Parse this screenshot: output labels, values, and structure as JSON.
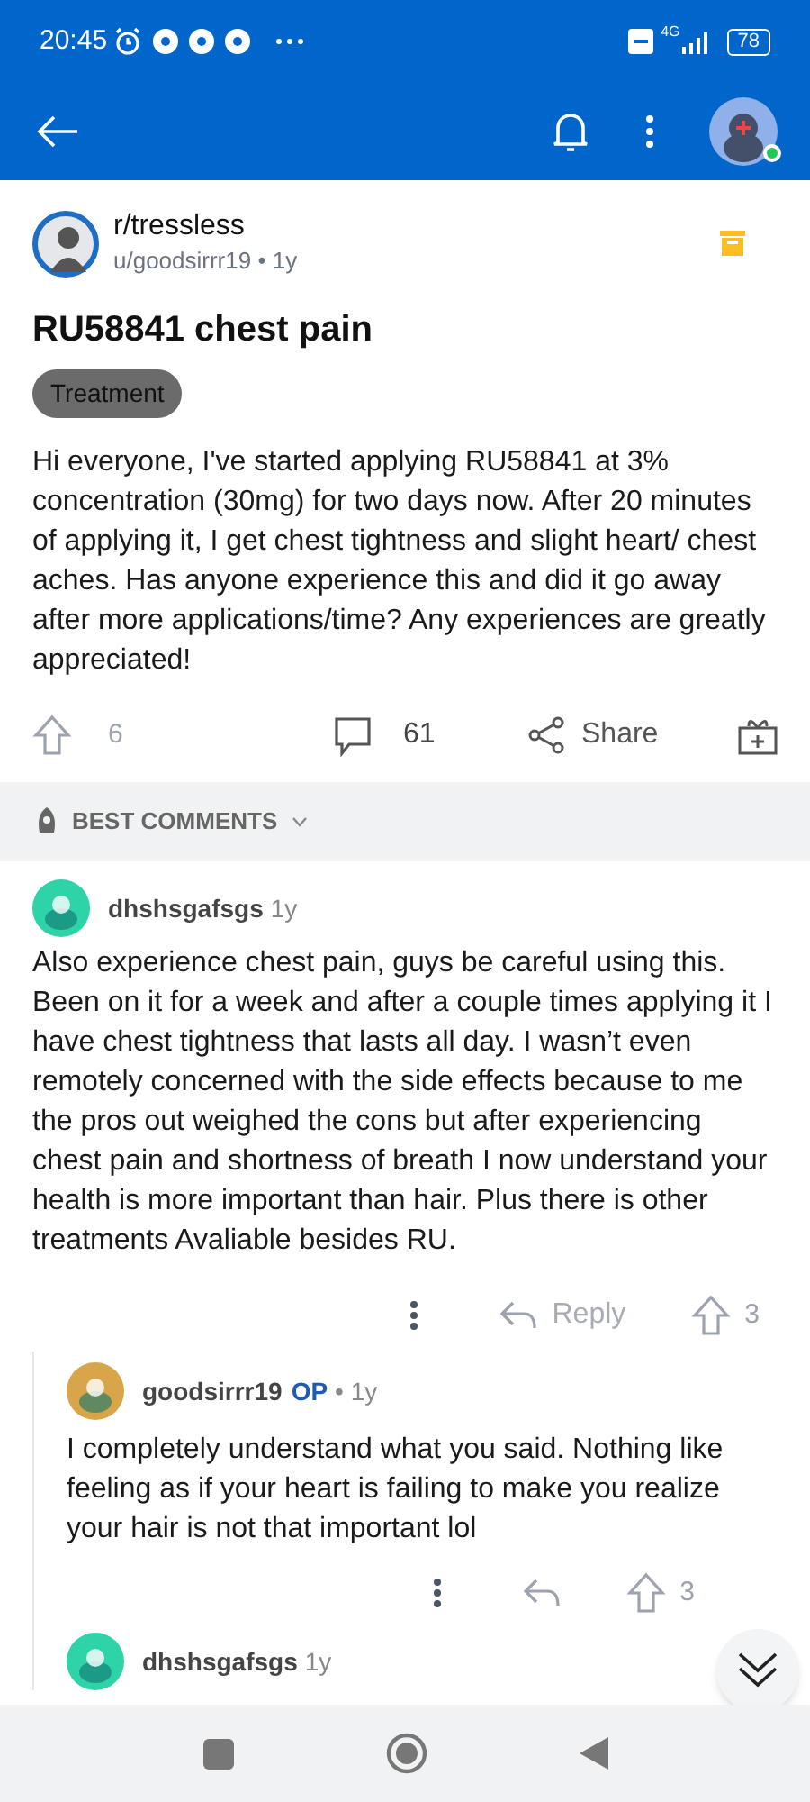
{
  "status_bar": {
    "time": "20:45",
    "battery": "78",
    "network": "4G"
  },
  "post": {
    "subreddit": "r/tressless",
    "meta": "u/goodsirrr19 • 1y",
    "title": "RU58841 chest pain",
    "flair": "Treatment",
    "body": "Hi everyone, I've started applying RU58841 at 3% concentration (30mg) for two days now. After 20 minutes of applying it, I get chest tightness and slight heart/ chest aches. Has anyone experience this and did it go away after more applications/time? Any experiences are greatly appreciated!",
    "votes": "6",
    "comments": "61",
    "share_label": "Share"
  },
  "sort": {
    "label": "BEST COMMENTS"
  },
  "comments": [
    {
      "author": "dhshsgafsgs",
      "age": "1y",
      "color": "#2ed3a8",
      "body": "Also experience chest pain, guys be careful using this. Been on it for a week and after a couple times applying it I have chest tightness that lasts all day. I wasn’t even remotely concerned with the side effects because to me the pros out weighed the cons but after experiencing chest pain and shortness of breath I now understand your health is more important than hair. Plus there is other treatments Avaliable besides RU.",
      "reply_label": "Reply",
      "votes": "3",
      "children": [
        {
          "author": "goodsirrr19",
          "op_label": "OP",
          "age": "• 1y",
          "color": "#d9a54a",
          "body": "I completely understand what you said. Nothing like feeling as if your heart is failing to make you realize your hair is not that important lol",
          "votes": "3"
        },
        {
          "author": "dhshsgafsgs",
          "age": "1y",
          "color": "#2ed3a8"
        }
      ]
    }
  ]
}
